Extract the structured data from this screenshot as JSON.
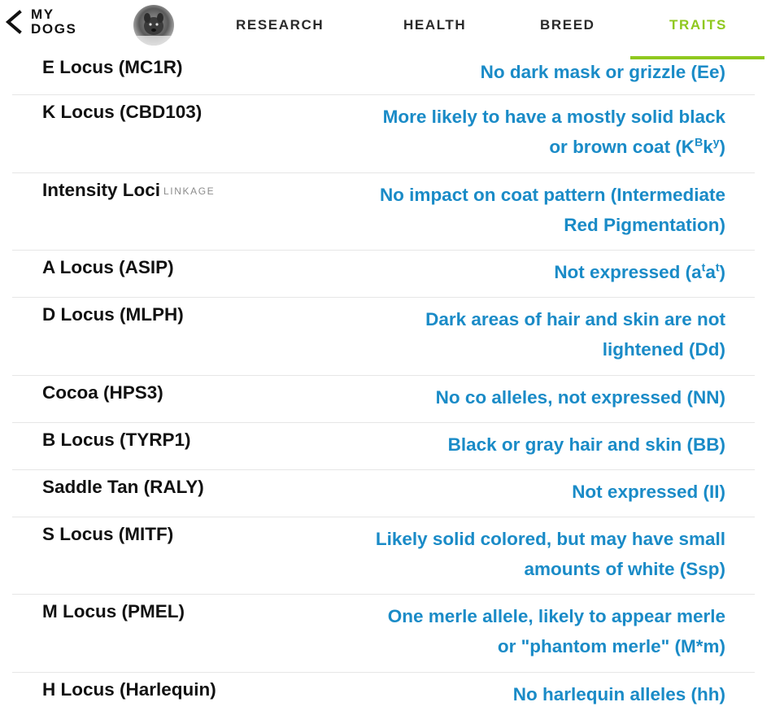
{
  "nav": {
    "back_line1": "MY",
    "back_line2": "DOGS",
    "tabs": [
      "RESEARCH",
      "HEALTH",
      "BREED",
      "TRAITS"
    ],
    "active_tab": "TRAITS"
  },
  "colors": {
    "accent": "#8fc81e",
    "value_text": "#1a8bc7",
    "divider": "#e6e6e6"
  },
  "traits": [
    {
      "label": "E Locus (MC1R)",
      "value": "No dark mask or grizzle (Ee)"
    },
    {
      "label": "K Locus (CBD103)",
      "value_line1": "More likely to have a mostly solid black",
      "value_line2_pre": "or brown coat (K",
      "value_line2_sup1": "B",
      "value_line2_mid": "k",
      "value_line2_sup2": "y",
      "value_line2_post": ")"
    },
    {
      "label": "Intensity Loci",
      "tag": "LINKAGE",
      "value_line1": "No impact on coat pattern (Intermediate",
      "value_line2": "Red Pigmentation)"
    },
    {
      "label": "A Locus (ASIP)",
      "value_pre": "Not expressed (a",
      "value_sup1": "t",
      "value_mid": "a",
      "value_sup2": "t",
      "value_post": ")"
    },
    {
      "label": "D Locus (MLPH)",
      "value_line1": "Dark areas of hair and skin are not",
      "value_line2": "lightened (Dd)"
    },
    {
      "label": "Cocoa (HPS3)",
      "value": "No co alleles, not expressed (NN)"
    },
    {
      "label": "B Locus (TYRP1)",
      "value": "Black or gray hair and skin (BB)"
    },
    {
      "label": "Saddle Tan (RALY)",
      "value": "Not expressed (II)"
    },
    {
      "label": "S Locus (MITF)",
      "value_line1": "Likely solid colored, but may have small",
      "value_line2": "amounts of white (Ssp)"
    },
    {
      "label": "M Locus (PMEL)",
      "value_line1": "One merle allele, likely to appear merle",
      "value_line2": "or \"phantom merle\" (M*m)"
    },
    {
      "label": "H Locus (Harlequin)",
      "value": "No harlequin alleles (hh)"
    }
  ]
}
